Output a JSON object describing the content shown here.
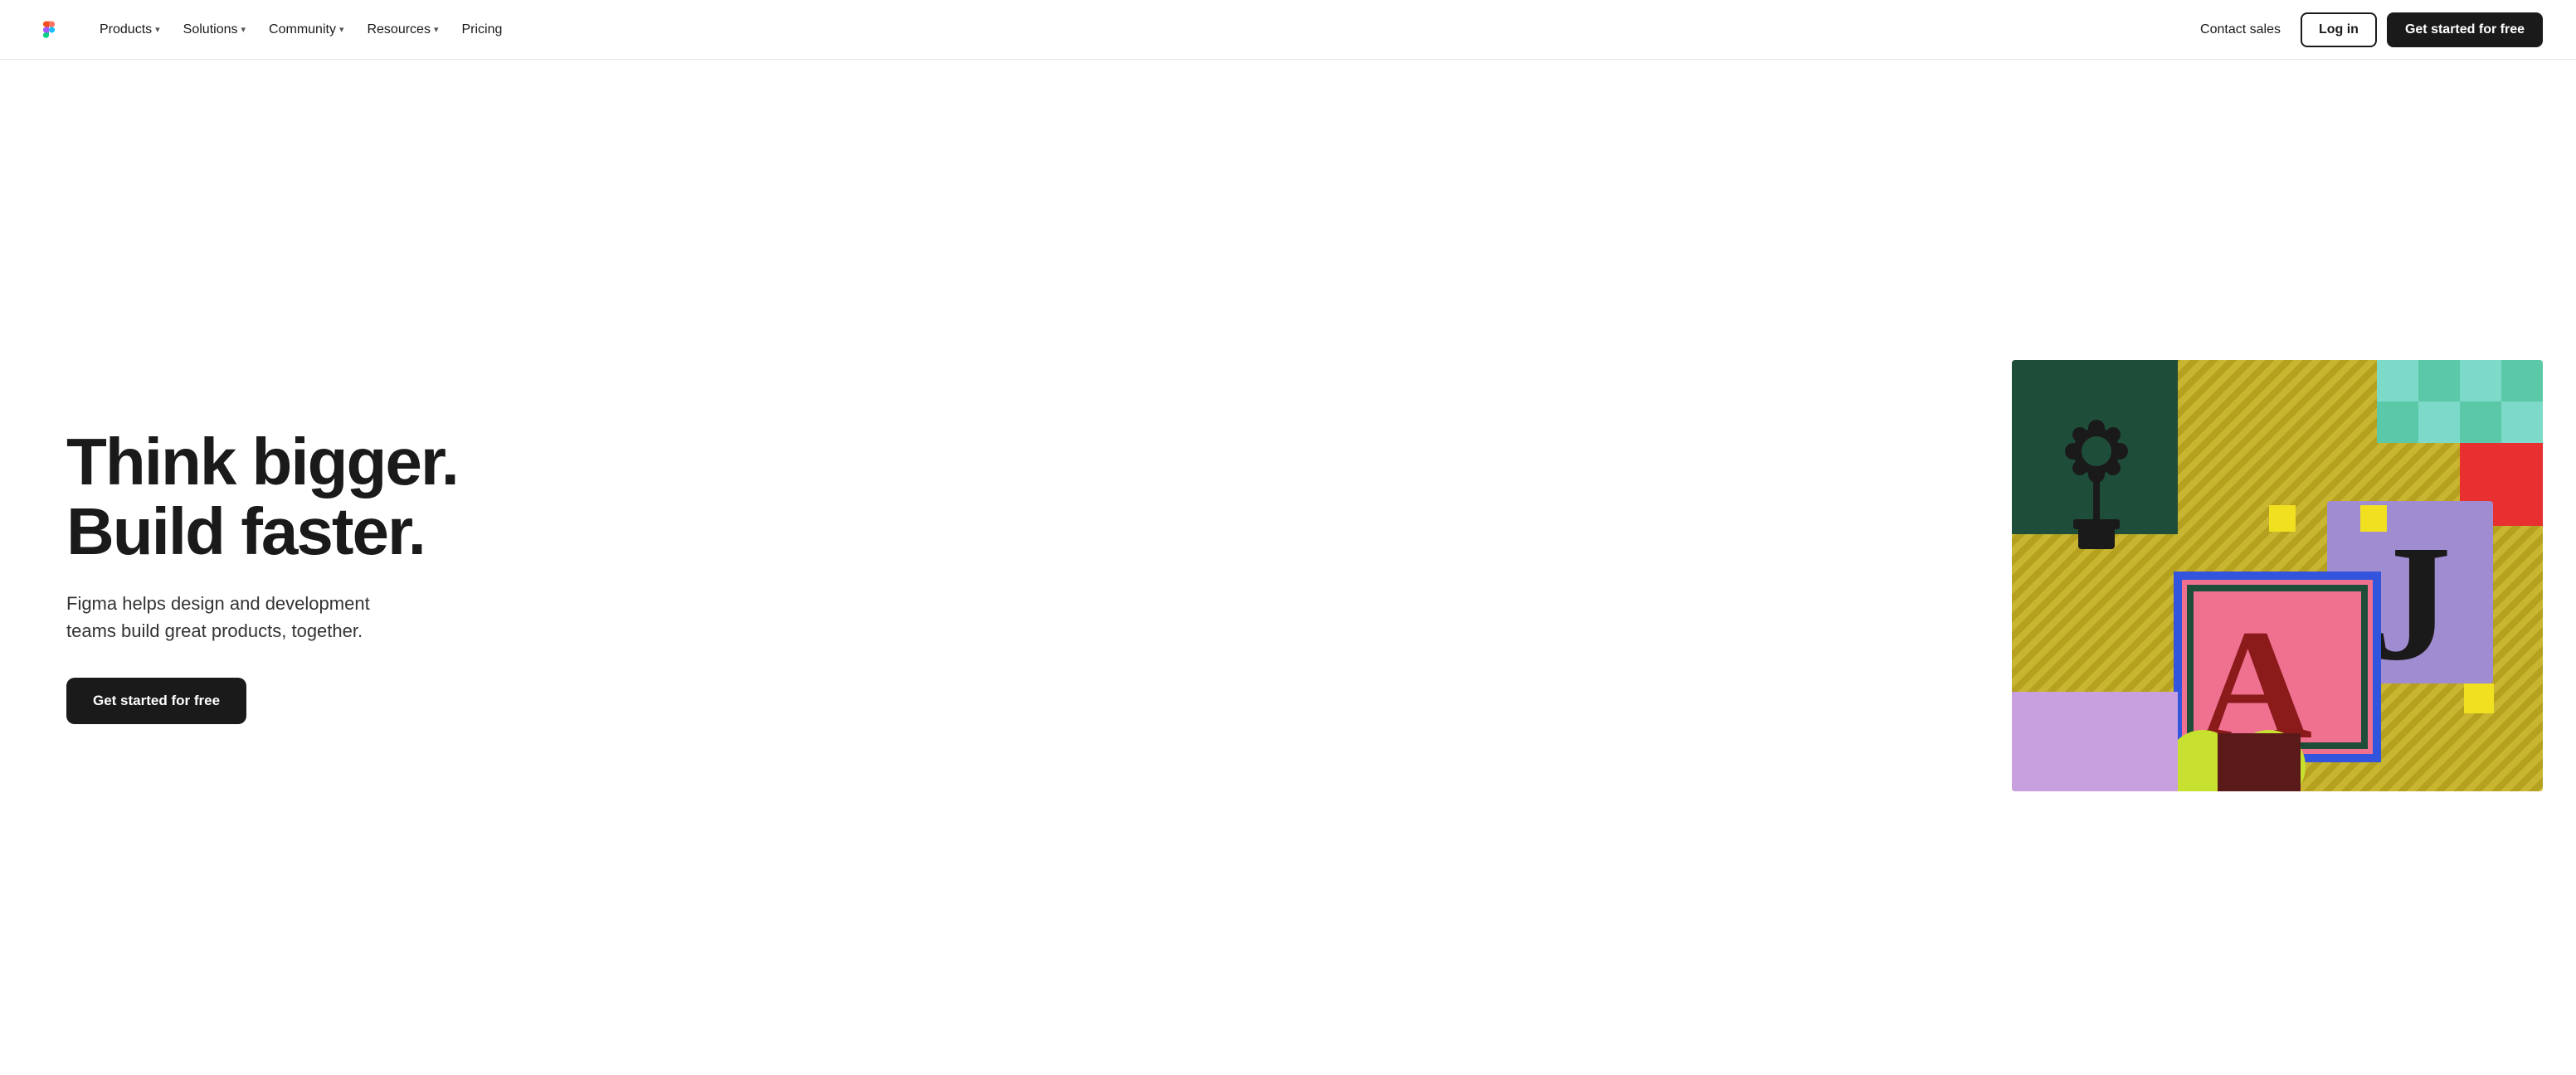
{
  "nav": {
    "logo_alt": "Figma",
    "links": [
      {
        "label": "Products",
        "has_dropdown": true
      },
      {
        "label": "Solutions",
        "has_dropdown": true
      },
      {
        "label": "Community",
        "has_dropdown": true
      },
      {
        "label": "Resources",
        "has_dropdown": true
      },
      {
        "label": "Pricing",
        "has_dropdown": false
      }
    ],
    "contact_label": "Contact sales",
    "login_label": "Log in",
    "cta_label": "Get started for free"
  },
  "hero": {
    "title_line1": "Think bigger.",
    "title_line2": "Build faster.",
    "subtitle": "Figma helps design and development teams build great products, together.",
    "cta_label": "Get started for free"
  }
}
